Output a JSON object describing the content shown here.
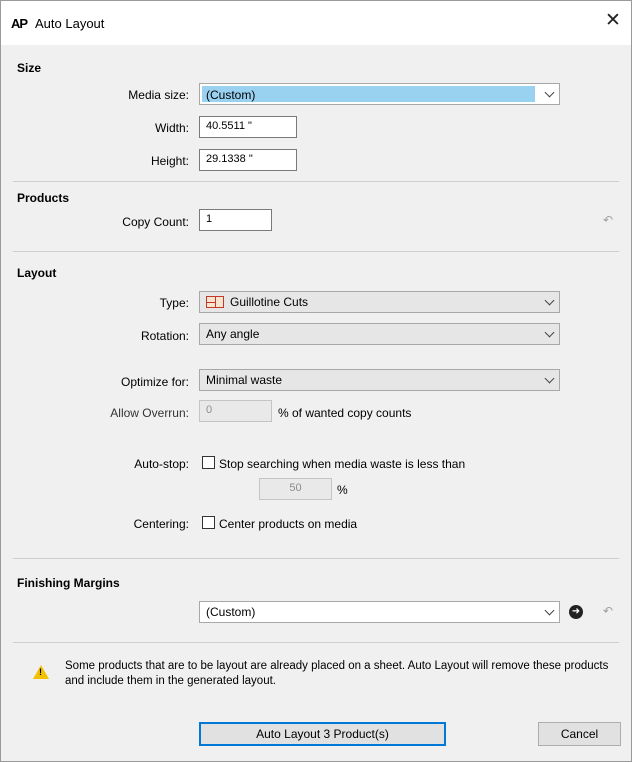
{
  "window": {
    "app_icon_text": "AP",
    "title": "Auto Layout",
    "close_label": "✕"
  },
  "size": {
    "heading": "Size",
    "media_size_label": "Media size:",
    "media_size_value": "(Custom)",
    "width_label": "Width:",
    "width_value": "40.5511 \"",
    "height_label": "Height:",
    "height_value": "29.1338 \""
  },
  "products": {
    "heading": "Products",
    "copy_count_label": "Copy Count:",
    "copy_count_value": "1",
    "undo_icon": "↶"
  },
  "layout": {
    "heading": "Layout",
    "type_label": "Type:",
    "type_value": "Guillotine Cuts",
    "rotation_label": "Rotation:",
    "rotation_value": "Any angle",
    "optimize_label": "Optimize for:",
    "optimize_value": "Minimal waste",
    "overrun_label": "Allow Overrun:",
    "overrun_value": "0",
    "overrun_suffix": "% of wanted copy counts",
    "autostop_label": "Auto-stop:",
    "autostop_text": "Stop searching when media waste is less than",
    "autostop_value": "50",
    "autostop_suffix": "%",
    "centering_label": "Centering:",
    "centering_text": "Center products on media"
  },
  "finishing": {
    "heading": "Finishing Margins",
    "value": "(Custom)",
    "go_icon": "➜",
    "undo_icon": "↶"
  },
  "warning": {
    "icon": "!",
    "text": "Some products that are to be layout are already placed on a sheet. Auto Layout will remove these products and include them in the generated layout."
  },
  "buttons": {
    "primary": "Auto Layout 3 Product(s)",
    "cancel": "Cancel"
  }
}
